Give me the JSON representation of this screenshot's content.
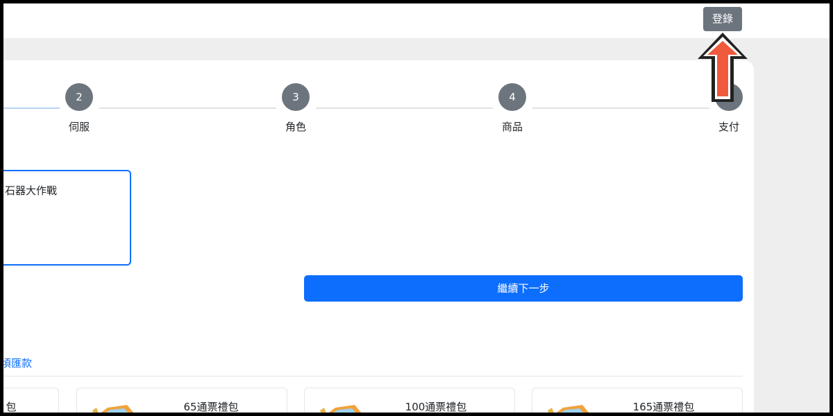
{
  "header": {
    "login_label": "登錄"
  },
  "stepper": {
    "steps": [
      {
        "number": "2",
        "label": "伺服"
      },
      {
        "number": "3",
        "label": "角色"
      },
      {
        "number": "4",
        "label": "商品"
      },
      {
        "number": "",
        "label": "支付"
      }
    ]
  },
  "game": {
    "selected_name": "石器大作戰"
  },
  "actions": {
    "next_label": "繼續下一步"
  },
  "section": {
    "link_text": "頃匯款"
  },
  "products": [
    {
      "title": "包"
    },
    {
      "title": "65通票禮包"
    },
    {
      "title": "100通票禮包"
    },
    {
      "title": "165通票禮包"
    }
  ],
  "colors": {
    "primary": "#0d6efd",
    "secondary": "#6c757d",
    "annotation_arrow": "#f05a3c"
  }
}
